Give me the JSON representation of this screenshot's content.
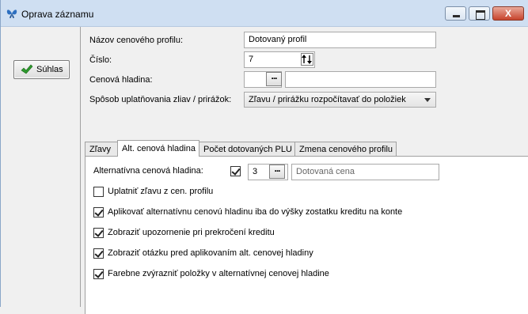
{
  "window": {
    "title": "Oprava záznamu",
    "close_glyph": "X"
  },
  "left_panel": {
    "ok_label": "Súhlas"
  },
  "form": {
    "profile_name": {
      "label": "Názov cenového profilu:",
      "value": "Dotovaný profil"
    },
    "number": {
      "label": "Číslo:",
      "value": "7"
    },
    "price_level": {
      "label": "Cenová hladina:",
      "value": "",
      "description": "",
      "dots": "..."
    },
    "discount_mode": {
      "label": "Spôsob uplatňovania zliav / prirážok:",
      "selected": "Zľavu / prirážku rozpočítavať do položiek"
    }
  },
  "tabs": [
    {
      "label": "Zľavy",
      "active": false
    },
    {
      "label": "Alt. cenová hladina",
      "active": true
    },
    {
      "label": "Počet dotovaných PLU",
      "active": false
    },
    {
      "label": "Zmena cenového profilu",
      "active": false
    }
  ],
  "alt_tab": {
    "alt_level_label": "Alternatívna cenová hladina:",
    "alt_level_checked": true,
    "alt_level_value": "3",
    "alt_level_dots": "...",
    "alt_level_name": "Dotovaná cena",
    "options": [
      {
        "label": "Uplatniť zľavu z cen. profilu",
        "checked": false
      },
      {
        "label": "Aplikovať alternatívnu cenovú hladinu iba do výšky zostatku kreditu na konte",
        "checked": true
      },
      {
        "label": "Zobraziť upozornenie pri prekročení kreditu",
        "checked": true
      },
      {
        "label": "Zobraziť otázku pred aplikovaním alt. cenovej hladiny",
        "checked": true
      },
      {
        "label": "Farebne zvýrazniť položky v alternatívnej cenovej hladine",
        "checked": true
      }
    ]
  },
  "colors": {
    "titlebar": "#cfdff2",
    "check_green": "#2e9a2e",
    "close_red": "#c7432c"
  }
}
